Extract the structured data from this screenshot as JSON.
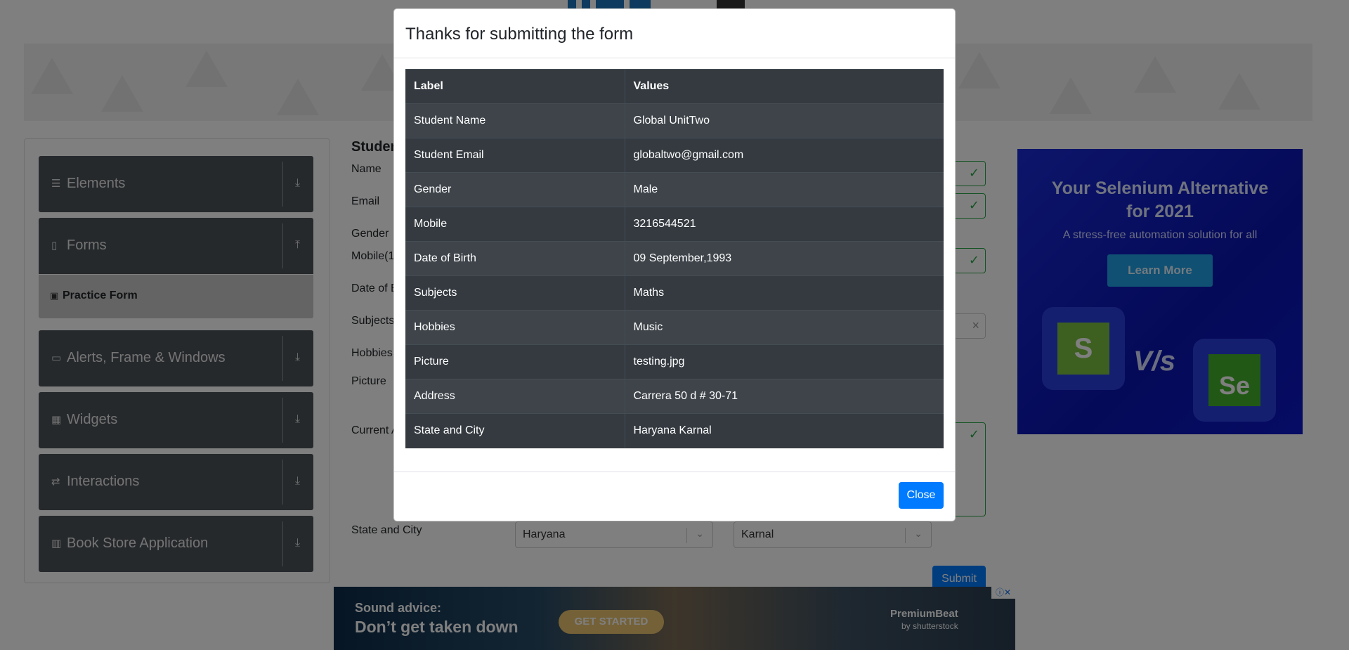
{
  "sidebar": {
    "groups": [
      {
        "label": "Elements",
        "icon": "menu-icon",
        "chevron": "download-icon"
      },
      {
        "label": "Forms",
        "icon": "document-icon",
        "chevron": "upload-icon"
      },
      {
        "label": "Alerts, Frame & Windows",
        "icon": "window-icon",
        "chevron": "download-icon"
      },
      {
        "label": "Widgets",
        "icon": "grid-icon",
        "chevron": "download-icon"
      },
      {
        "label": "Interactions",
        "icon": "interaction-icon",
        "chevron": "download-icon"
      },
      {
        "label": "Book Store Application",
        "icon": "books-icon",
        "chevron": "download-icon"
      }
    ],
    "active_item": "Practice Form"
  },
  "form": {
    "heading": "Studen",
    "labels": {
      "name": "Name",
      "email": "Email",
      "gender": "Gender",
      "mobile": "Mobile(1",
      "dob": "Date of B",
      "subjects": "Subjects",
      "hobbies": "Hobbies",
      "picture": "Picture",
      "address": "Current A",
      "state_city": "State and City"
    },
    "state_value": "Haryana",
    "city_value": "Karnal",
    "submit_label": "Submit"
  },
  "ad_right": {
    "title_line1": "Your Selenium Alternative",
    "title_line2": "for 2021",
    "subtitle": "A stress-free automation solution for all",
    "button": "Learn More",
    "vs": "V/s",
    "left_logo": "S",
    "right_logo": "Se"
  },
  "ad_bottom": {
    "line1": "Sound advice:",
    "line2": "Don’t get taken down",
    "cta": "GET STARTED",
    "brand": "PremiumBeat",
    "brand_sub": "by shutterstock"
  },
  "modal": {
    "title": "Thanks for submitting the form",
    "columns": [
      "Label",
      "Values"
    ],
    "rows": [
      {
        "label": "Student Name",
        "value": "Global UnitTwo"
      },
      {
        "label": "Student Email",
        "value": "globaltwo@gmail.com"
      },
      {
        "label": "Gender",
        "value": "Male"
      },
      {
        "label": "Mobile",
        "value": "3216544521"
      },
      {
        "label": "Date of Birth",
        "value": "09 September,1993"
      },
      {
        "label": "Subjects",
        "value": "Maths"
      },
      {
        "label": "Hobbies",
        "value": "Music"
      },
      {
        "label": "Picture",
        "value": "testing.jpg"
      },
      {
        "label": "Address",
        "value": "Carrera 50 d # 30-71"
      },
      {
        "label": "State and City",
        "value": "Haryana Karnal"
      }
    ],
    "close_label": "Close"
  },
  "colors": {
    "primary": "#007bff",
    "success": "#28a745",
    "sidebar_bg": "#4d5358",
    "table_dark": "#343a40"
  }
}
